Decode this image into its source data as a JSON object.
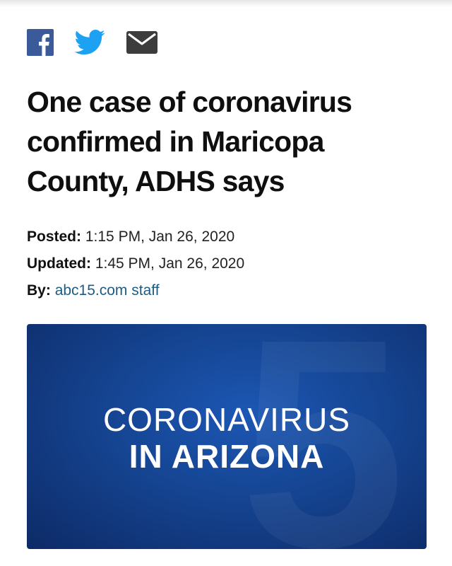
{
  "share": {
    "icons": [
      "facebook-icon",
      "twitter-icon",
      "mail-icon"
    ],
    "colors": {
      "facebook": "#3a5a99",
      "twitter": "#1da1f2",
      "mail": "#3c3c3c"
    }
  },
  "article": {
    "headline": "One case of coronavirus confirmed in Maricopa County, ADHS says",
    "posted_label": "Posted:",
    "posted_value": "1:15 PM, Jan 26, 2020",
    "updated_label": "Updated:",
    "updated_value": "1:45 PM, Jan 26, 2020",
    "by_label": "By:",
    "by_value": "abc15.com staff"
  },
  "hero": {
    "line1": "CORONAVIRUS",
    "line2": "IN ARIZONA"
  },
  "colors": {
    "link": "#1d5b83",
    "hero_blue": "#154491"
  }
}
